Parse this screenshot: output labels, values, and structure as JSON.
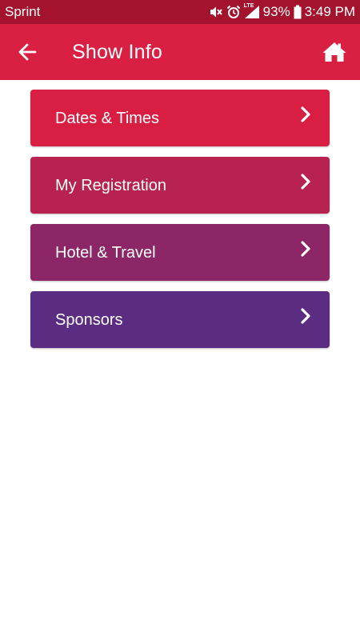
{
  "status_bar": {
    "carrier": "Sprint",
    "network": "LTE",
    "battery": "93%",
    "time": "3:49 PM",
    "icons": [
      "mute-icon",
      "alarm-icon",
      "signal-icon",
      "battery-icon"
    ],
    "background": "#a4132e"
  },
  "header": {
    "title": "Show Info",
    "back_icon": "arrow-left-icon",
    "home_icon": "home-icon",
    "background": "#d91f42"
  },
  "menu": {
    "items": [
      {
        "label": "Dates & Times",
        "color": "#d81f43",
        "icon": "chevron-right-icon"
      },
      {
        "label": "My Registration",
        "color": "#b72250",
        "icon": "chevron-right-icon"
      },
      {
        "label": "Hotel & Travel",
        "color": "#8d2666",
        "icon": "chevron-right-icon"
      },
      {
        "label": "Sponsors",
        "color": "#5a2d82",
        "icon": "chevron-right-icon"
      }
    ]
  }
}
